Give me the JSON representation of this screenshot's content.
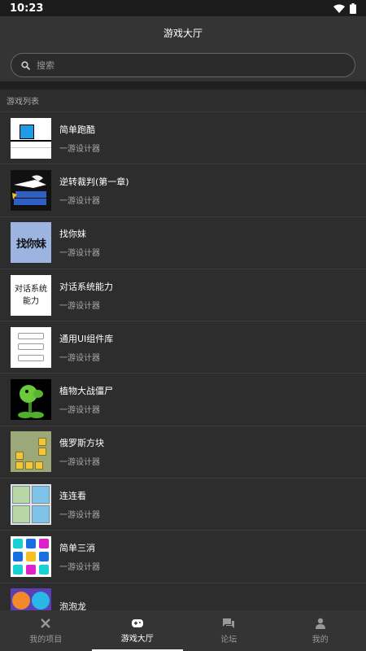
{
  "status": {
    "time": "10:23"
  },
  "header": {
    "title": "游戏大厅"
  },
  "search": {
    "placeholder": "搜索"
  },
  "list": {
    "section_title": "游戏列表",
    "items": [
      {
        "title": "简单跑酷",
        "subtitle": "一游设计器",
        "icon": "parkour-thumb"
      },
      {
        "title": "逆转裁判(第一章)",
        "subtitle": "一游设计器",
        "icon": "ace-attorney-thumb"
      },
      {
        "title": "找你妹",
        "subtitle": "一游设计器",
        "icon": "find-it-thumb",
        "thumb_text": "找你妹"
      },
      {
        "title": "对话系统能力",
        "subtitle": "一游设计器",
        "icon": "dialog-system-thumb",
        "thumb_text": "对话系统\n能力"
      },
      {
        "title": "通用UI组件库",
        "subtitle": "一游设计器",
        "icon": "ui-components-thumb"
      },
      {
        "title": "植物大战僵尸",
        "subtitle": "一游设计器",
        "icon": "pvz-thumb"
      },
      {
        "title": "俄罗斯方块",
        "subtitle": "一游设计器",
        "icon": "tetris-thumb"
      },
      {
        "title": "连连看",
        "subtitle": "一游设计器",
        "icon": "link-match-thumb"
      },
      {
        "title": "简单三消",
        "subtitle": "一游设计器",
        "icon": "match3-thumb"
      },
      {
        "title": "泡泡龙",
        "subtitle": "",
        "icon": "bubble-thumb"
      }
    ]
  },
  "nav": {
    "items": [
      {
        "label": "我的项目",
        "icon": "tools-icon"
      },
      {
        "label": "游戏大厅",
        "icon": "gamepad-icon"
      },
      {
        "label": "论坛",
        "icon": "forum-icon"
      },
      {
        "label": "我的",
        "icon": "person-icon"
      }
    ]
  },
  "colors": {
    "background": "#2b2b2b",
    "bar": "#343434",
    "active": "#ffffff",
    "inactive": "#999999"
  }
}
